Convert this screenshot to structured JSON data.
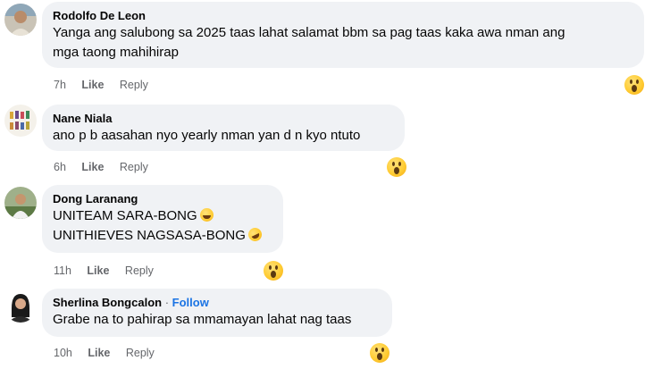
{
  "comments": [
    {
      "author": "Rodolfo De Leon",
      "lines": [
        "Yanga ang salubong sa 2025 taas lahat salamat bbm sa pag taas kaka awa nman ang",
        "mga taong mahihirap"
      ],
      "time": "7h",
      "like": "Like",
      "reply": "Reply",
      "reaction": "wow-reaction-icon"
    },
    {
      "author": "Nane Niala",
      "lines": [
        "ano p b aasahan nyo yearly nman yan d n kyo ntuto"
      ],
      "time": "6h",
      "like": "Like",
      "reply": "Reply",
      "reaction": "wow-reaction-icon"
    },
    {
      "author": "Dong Laranang",
      "lines": [
        "UNITEAM SARA-BONG",
        "UNITHIEVES NAGSASA-BONG"
      ],
      "emojis": [
        "grinning-sweat-emoji",
        "rofl-emoji"
      ],
      "time": "11h",
      "like": "Like",
      "reply": "Reply",
      "reaction": "wow-reaction-icon"
    },
    {
      "author": "Sherlina Bongcalon",
      "separator": "·",
      "follow": "Follow",
      "lines": [
        "Grabe na to pahirap sa mmamayan lahat nag taas"
      ],
      "time": "10h",
      "like": "Like",
      "reply": "Reply",
      "reaction": "wow-reaction-icon"
    }
  ],
  "colors": {
    "bubble": "#f0f2f5",
    "meta": "#65676b",
    "follow": "#1b74e4",
    "text": "#050505"
  }
}
